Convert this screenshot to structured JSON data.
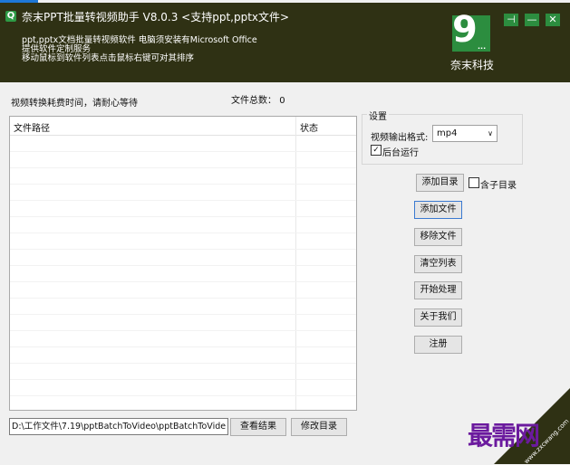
{
  "window": {
    "title": "奈末PPT批量转视频助手  V8.0.3 <支持ppt,pptx文件>",
    "app_icon_glyph": "Q",
    "description_lines": [
      "ppt,pptx文档批量转视频软件 电脑须安装有Microsoft Office",
      "提供软件定制服务",
      "移动鼠标到软件列表点击鼠标右键可对其排序"
    ],
    "logo_glyph": "9",
    "logo_dots": "...",
    "logo_text": "奈末科技",
    "controls": {
      "pin": "⊣",
      "minimize": "—",
      "close": "✕"
    }
  },
  "main": {
    "info": "视频转换耗费时间，请耐心等待",
    "file_count_label": "文件总数：",
    "file_count": "0",
    "list_columns": [
      "文件路径",
      "状态"
    ]
  },
  "settings": {
    "legend": "设置",
    "format_label": "视频输出格式:",
    "format_value": "mp4",
    "background_run": {
      "label": "后台运行",
      "checked": true
    }
  },
  "buttons": {
    "add_dir": "添加目录",
    "include_subdir": {
      "label": "含子目录",
      "checked": false
    },
    "add_file": "添加文件",
    "remove_file": "移除文件",
    "clear_list": "清空列表",
    "start": "开始处理",
    "about": "关于我们",
    "register": "注册"
  },
  "bottom": {
    "output_path": "D:\\工作文件\\7.19\\pptBatchToVideo\\pptBatchToVide",
    "view_result": "查看结果",
    "change_dir": "修改目录"
  },
  "watermark": {
    "text": "最需网",
    "corner_text": "www.zxcwang.com"
  },
  "colors": {
    "header_bg": "#2f3114",
    "accent_green": "#2c8d3f",
    "watermark": "#6b1a9e"
  }
}
